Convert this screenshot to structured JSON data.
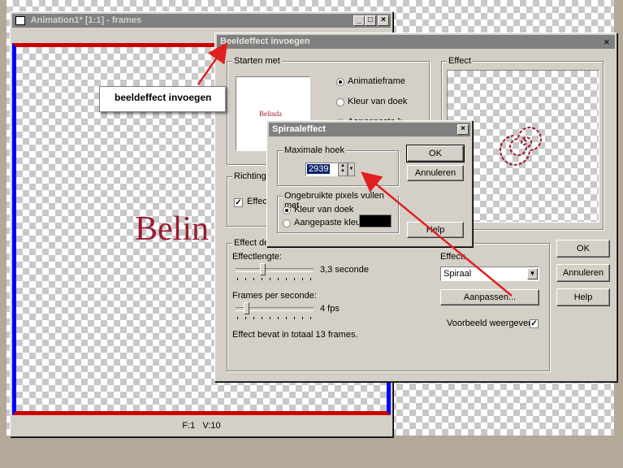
{
  "anim_window": {
    "title": "Animation1* [1:1] - frames",
    "status_frame": "F:1",
    "status_view": "V:10",
    "canvas_text": "Belin"
  },
  "insert_dialog": {
    "title": "Beeldeffect invoegen",
    "start_group": "Starten met",
    "preview_text": "Belinda",
    "radio_animframe": "Animatieframe",
    "radio_canvas": "Kleur van doek",
    "radio_custom_partial": "Aangepaste k",
    "effect_group": "Effect",
    "direction_group": "Richting",
    "direction_check": "Effect",
    "effectdef_group": "Effect defi",
    "effect_length_label": "Effectlengte:",
    "effect_length_value": "3,3 seconde",
    "fps_label": "Frames per seconde:",
    "fps_value": "4 fps",
    "frames_total": "Effect bevat in totaal 13 frames.",
    "effect_label": "Effect:",
    "effect_select": "Spiraal",
    "customize_button": "Aanpassen...",
    "preview_check": "Voorbeeld weergeven",
    "ok": "OK",
    "cancel": "Annuleren",
    "help": "Help"
  },
  "spiral_dialog": {
    "title": "Spiraaleffect",
    "max_angle_group": "Maximale hoek",
    "max_angle_value": "2939",
    "unused_group": "Ongebruikte pixels vullen met",
    "radio_canvas": "Kleur van doek",
    "radio_custom": "Aangepaste kleur",
    "custom_color": "#000000",
    "ok": "OK",
    "cancel": "Annuleren",
    "help": "Help"
  },
  "callout": {
    "text": "beeldeffect invoegen"
  },
  "colors": {
    "arrow": "#e02020",
    "title_active": "#404040",
    "dialog_bg": "#d4d0c8",
    "frame_blue": "#0000ff",
    "frame_red": "#cc0000",
    "belinda_text": "#9b1b30"
  }
}
